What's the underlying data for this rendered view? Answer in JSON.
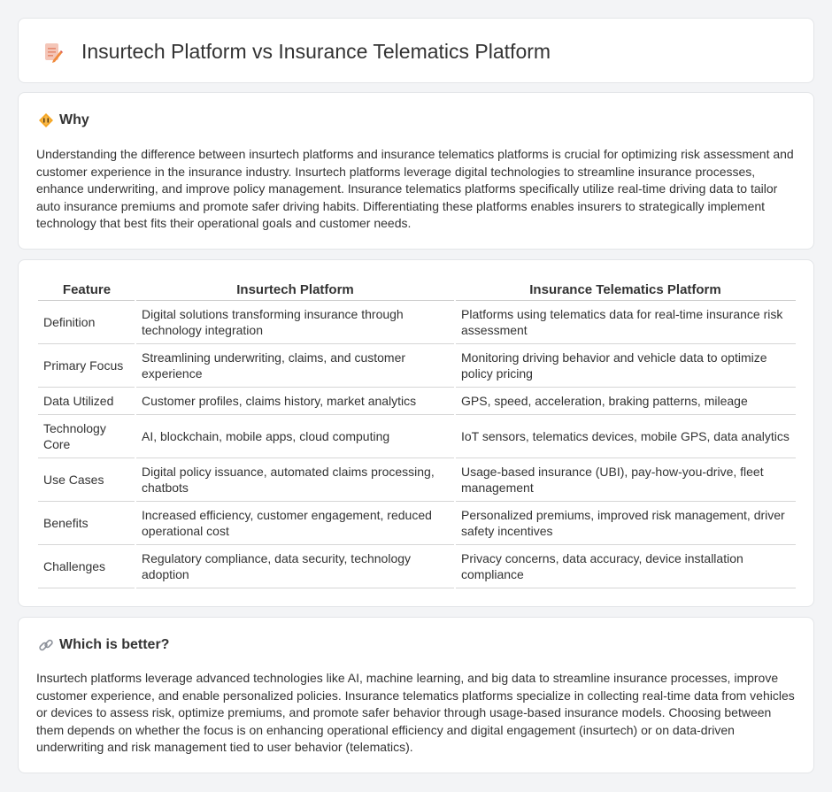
{
  "header": {
    "title": "Insurtech Platform vs Insurance Telematics Platform",
    "icon": "document-edit-icon"
  },
  "why": {
    "heading": "Why",
    "icon": "road-sign-icon",
    "text": "Understanding the difference between insurtech platforms and insurance telematics platforms is crucial for optimizing risk assessment and customer experience in the insurance industry. Insurtech platforms leverage digital technologies to streamline insurance processes, enhance underwriting, and improve policy management. Insurance telematics platforms specifically utilize real-time driving data to tailor auto insurance premiums and promote safer driving habits. Differentiating these platforms enables insurers to strategically implement technology that best fits their operational goals and customer needs."
  },
  "table": {
    "headers": [
      "Feature",
      "Insurtech Platform",
      "Insurance Telematics Platform"
    ],
    "rows": [
      [
        "Definition",
        "Digital solutions transforming insurance through technology integration",
        "Platforms using telematics data for real-time insurance risk assessment"
      ],
      [
        "Primary Focus",
        "Streamlining underwriting, claims, and customer experience",
        "Monitoring driving behavior and vehicle data to optimize policy pricing"
      ],
      [
        "Data Utilized",
        "Customer profiles, claims history, market analytics",
        "GPS, speed, acceleration, braking patterns, mileage"
      ],
      [
        "Technology Core",
        "AI, blockchain, mobile apps, cloud computing",
        "IoT sensors, telematics devices, mobile GPS, data analytics"
      ],
      [
        "Use Cases",
        "Digital policy issuance, automated claims processing, chatbots",
        "Usage-based insurance (UBI), pay-how-you-drive, fleet management"
      ],
      [
        "Benefits",
        "Increased efficiency, customer engagement, reduced operational cost",
        "Personalized premiums, improved risk management, driver safety incentives"
      ],
      [
        "Challenges",
        "Regulatory compliance, data security, technology adoption",
        "Privacy concerns, data accuracy, device installation compliance"
      ]
    ]
  },
  "better": {
    "heading": "Which is better?",
    "icon": "link-icon",
    "text": "Insurtech platforms leverage advanced technologies like AI, machine learning, and big data to streamline insurance processes, improve customer experience, and enable personalized policies. Insurance telematics platforms specialize in collecting real-time data from vehicles or devices to assess risk, optimize premiums, and promote safer behavior through usage-based insurance models. Choosing between them depends on whether the focus is on enhancing operational efficiency and digital engagement (insurtech) or on data-driven underwriting and risk management tied to user behavior (telematics)."
  }
}
